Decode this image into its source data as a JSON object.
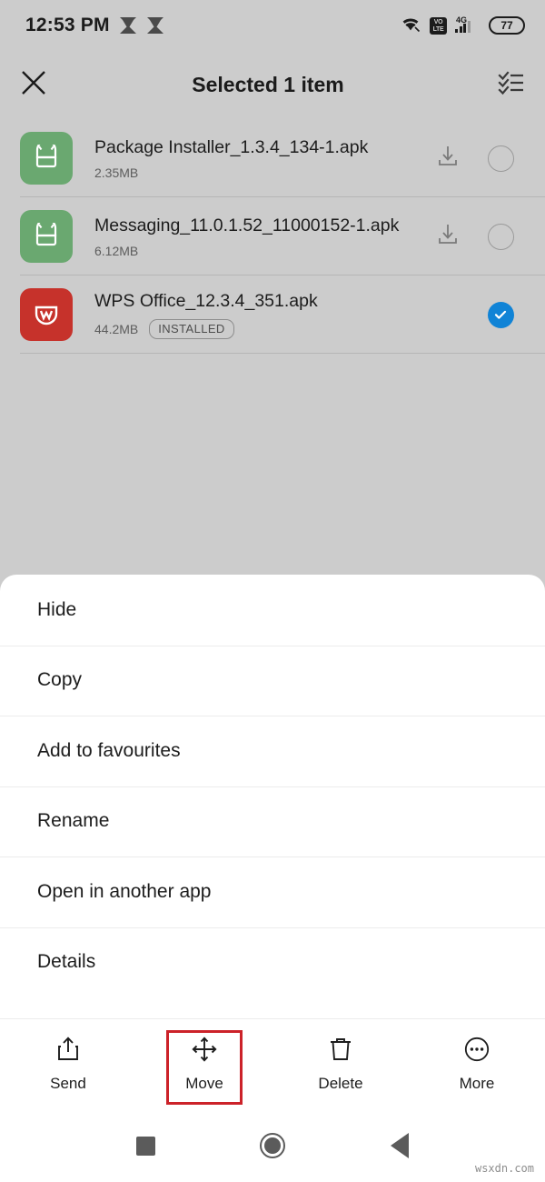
{
  "status_bar": {
    "time": "12:53 PM",
    "icons": [
      "vpn-icon",
      "vpn-icon",
      "wifi-icon",
      "volte-icon",
      "signal-4g-icon",
      "battery-icon"
    ],
    "network_type": "4G",
    "volte_top": "VO",
    "volte_bottom": "LTE",
    "battery_level": "77"
  },
  "app_bar": {
    "close_icon": "close-icon",
    "title": "Selected 1 item",
    "select_all_icon": "select-all-icon"
  },
  "files": [
    {
      "name": "Package Installer_1.3.4_134-1.apk",
      "size": "2.35MB",
      "badge": "",
      "icon": "android-apk-icon",
      "icon_color": "#6aa870",
      "action_icon": "install-download-icon",
      "selected": false
    },
    {
      "name": "Messaging_11.0.1.52_11000152-1.apk",
      "size": "6.12MB",
      "badge": "",
      "icon": "android-apk-icon",
      "icon_color": "#6aa870",
      "action_icon": "install-download-icon",
      "selected": false
    },
    {
      "name": "WPS Office_12.3.4_351.apk",
      "size": "44.2MB",
      "badge": "INSTALLED",
      "icon": "wps-office-icon",
      "icon_color": "#c6322b",
      "action_icon": "",
      "selected": true
    }
  ],
  "menu": {
    "items": [
      {
        "label": "Hide"
      },
      {
        "label": "Copy"
      },
      {
        "label": "Add to favourites"
      },
      {
        "label": "Rename"
      },
      {
        "label": "Open in another app"
      },
      {
        "label": "Details"
      }
    ]
  },
  "action_bar": {
    "items": [
      {
        "label": "Send",
        "icon": "share-icon",
        "highlighted": false
      },
      {
        "label": "Move",
        "icon": "move-arrows-icon",
        "highlighted": true
      },
      {
        "label": "Delete",
        "icon": "trash-icon",
        "highlighted": false
      },
      {
        "label": "More",
        "icon": "more-ellipsis-icon",
        "highlighted": false
      }
    ],
    "highlight_color": "#cc2229"
  },
  "nav_bar": {
    "recents": "recents-square-icon",
    "home": "home-circle-icon",
    "back": "back-triangle-icon"
  },
  "watermark": "wsxdn.com",
  "colors": {
    "background": "#cccccc",
    "sheet": "#ffffff",
    "accent_selected": "#1083d6",
    "apk_green": "#6aa870",
    "wps_red": "#c6322b",
    "highlight_red": "#cc2229"
  }
}
